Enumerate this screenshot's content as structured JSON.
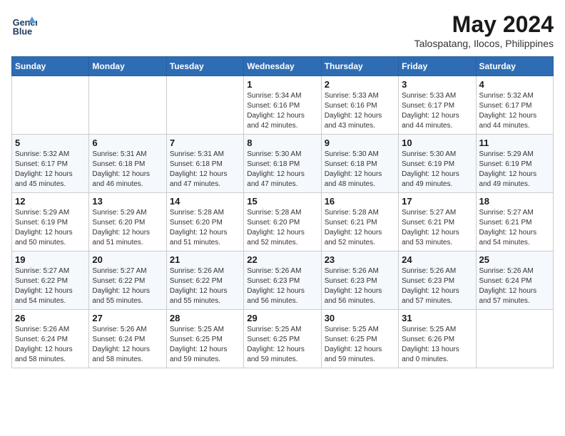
{
  "header": {
    "logo_line1": "General",
    "logo_line2": "Blue",
    "month_year": "May 2024",
    "location": "Talospatang, Ilocos, Philippines"
  },
  "weekdays": [
    "Sunday",
    "Monday",
    "Tuesday",
    "Wednesday",
    "Thursday",
    "Friday",
    "Saturday"
  ],
  "weeks": [
    [
      {
        "day": "",
        "info": ""
      },
      {
        "day": "",
        "info": ""
      },
      {
        "day": "",
        "info": ""
      },
      {
        "day": "1",
        "info": "Sunrise: 5:34 AM\nSunset: 6:16 PM\nDaylight: 12 hours\nand 42 minutes."
      },
      {
        "day": "2",
        "info": "Sunrise: 5:33 AM\nSunset: 6:16 PM\nDaylight: 12 hours\nand 43 minutes."
      },
      {
        "day": "3",
        "info": "Sunrise: 5:33 AM\nSunset: 6:17 PM\nDaylight: 12 hours\nand 44 minutes."
      },
      {
        "day": "4",
        "info": "Sunrise: 5:32 AM\nSunset: 6:17 PM\nDaylight: 12 hours\nand 44 minutes."
      }
    ],
    [
      {
        "day": "5",
        "info": "Sunrise: 5:32 AM\nSunset: 6:17 PM\nDaylight: 12 hours\nand 45 minutes."
      },
      {
        "day": "6",
        "info": "Sunrise: 5:31 AM\nSunset: 6:18 PM\nDaylight: 12 hours\nand 46 minutes."
      },
      {
        "day": "7",
        "info": "Sunrise: 5:31 AM\nSunset: 6:18 PM\nDaylight: 12 hours\nand 47 minutes."
      },
      {
        "day": "8",
        "info": "Sunrise: 5:30 AM\nSunset: 6:18 PM\nDaylight: 12 hours\nand 47 minutes."
      },
      {
        "day": "9",
        "info": "Sunrise: 5:30 AM\nSunset: 6:18 PM\nDaylight: 12 hours\nand 48 minutes."
      },
      {
        "day": "10",
        "info": "Sunrise: 5:30 AM\nSunset: 6:19 PM\nDaylight: 12 hours\nand 49 minutes."
      },
      {
        "day": "11",
        "info": "Sunrise: 5:29 AM\nSunset: 6:19 PM\nDaylight: 12 hours\nand 49 minutes."
      }
    ],
    [
      {
        "day": "12",
        "info": "Sunrise: 5:29 AM\nSunset: 6:19 PM\nDaylight: 12 hours\nand 50 minutes."
      },
      {
        "day": "13",
        "info": "Sunrise: 5:29 AM\nSunset: 6:20 PM\nDaylight: 12 hours\nand 51 minutes."
      },
      {
        "day": "14",
        "info": "Sunrise: 5:28 AM\nSunset: 6:20 PM\nDaylight: 12 hours\nand 51 minutes."
      },
      {
        "day": "15",
        "info": "Sunrise: 5:28 AM\nSunset: 6:20 PM\nDaylight: 12 hours\nand 52 minutes."
      },
      {
        "day": "16",
        "info": "Sunrise: 5:28 AM\nSunset: 6:21 PM\nDaylight: 12 hours\nand 52 minutes."
      },
      {
        "day": "17",
        "info": "Sunrise: 5:27 AM\nSunset: 6:21 PM\nDaylight: 12 hours\nand 53 minutes."
      },
      {
        "day": "18",
        "info": "Sunrise: 5:27 AM\nSunset: 6:21 PM\nDaylight: 12 hours\nand 54 minutes."
      }
    ],
    [
      {
        "day": "19",
        "info": "Sunrise: 5:27 AM\nSunset: 6:22 PM\nDaylight: 12 hours\nand 54 minutes."
      },
      {
        "day": "20",
        "info": "Sunrise: 5:27 AM\nSunset: 6:22 PM\nDaylight: 12 hours\nand 55 minutes."
      },
      {
        "day": "21",
        "info": "Sunrise: 5:26 AM\nSunset: 6:22 PM\nDaylight: 12 hours\nand 55 minutes."
      },
      {
        "day": "22",
        "info": "Sunrise: 5:26 AM\nSunset: 6:23 PM\nDaylight: 12 hours\nand 56 minutes."
      },
      {
        "day": "23",
        "info": "Sunrise: 5:26 AM\nSunset: 6:23 PM\nDaylight: 12 hours\nand 56 minutes."
      },
      {
        "day": "24",
        "info": "Sunrise: 5:26 AM\nSunset: 6:23 PM\nDaylight: 12 hours\nand 57 minutes."
      },
      {
        "day": "25",
        "info": "Sunrise: 5:26 AM\nSunset: 6:24 PM\nDaylight: 12 hours\nand 57 minutes."
      }
    ],
    [
      {
        "day": "26",
        "info": "Sunrise: 5:26 AM\nSunset: 6:24 PM\nDaylight: 12 hours\nand 58 minutes."
      },
      {
        "day": "27",
        "info": "Sunrise: 5:26 AM\nSunset: 6:24 PM\nDaylight: 12 hours\nand 58 minutes."
      },
      {
        "day": "28",
        "info": "Sunrise: 5:25 AM\nSunset: 6:25 PM\nDaylight: 12 hours\nand 59 minutes."
      },
      {
        "day": "29",
        "info": "Sunrise: 5:25 AM\nSunset: 6:25 PM\nDaylight: 12 hours\nand 59 minutes."
      },
      {
        "day": "30",
        "info": "Sunrise: 5:25 AM\nSunset: 6:25 PM\nDaylight: 12 hours\nand 59 minutes."
      },
      {
        "day": "31",
        "info": "Sunrise: 5:25 AM\nSunset: 6:26 PM\nDaylight: 13 hours\nand 0 minutes."
      },
      {
        "day": "",
        "info": ""
      }
    ]
  ]
}
